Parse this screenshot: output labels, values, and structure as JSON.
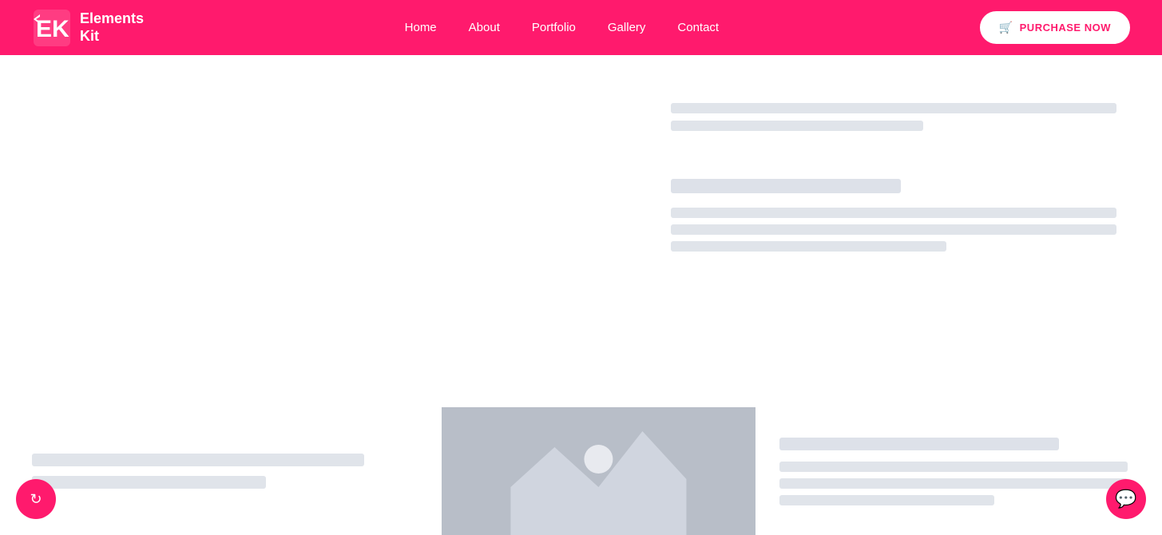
{
  "navbar": {
    "logo_text_line1": "Elements",
    "logo_text_line2": "Kit",
    "nav_items": [
      {
        "label": "Home",
        "id": "home"
      },
      {
        "label": "About",
        "id": "about"
      },
      {
        "label": "Portfolio",
        "id": "portfolio"
      },
      {
        "label": "Gallery",
        "id": "gallery"
      },
      {
        "label": "Contact",
        "id": "contact"
      }
    ],
    "purchase_button": "PURCHASE NOW"
  },
  "content": {
    "top_right": {
      "line1_width": "97%",
      "line2_width": "55%"
    },
    "mid_right": {
      "title_width": "50%",
      "line1_width": "97%",
      "line2_width": "97%",
      "line3_width": "60%"
    }
  },
  "bottom": {
    "left_line1": "",
    "left_line2": "",
    "right_title": "",
    "right_line1": "",
    "right_line2": "",
    "right_line3": ""
  },
  "icons": {
    "cart": "🛒",
    "chat": "💬",
    "refresh": "🔄"
  },
  "colors": {
    "primary": "#ff1a6d",
    "skeleton": "#e0e4ea",
    "image_bg": "#b8bec8"
  }
}
